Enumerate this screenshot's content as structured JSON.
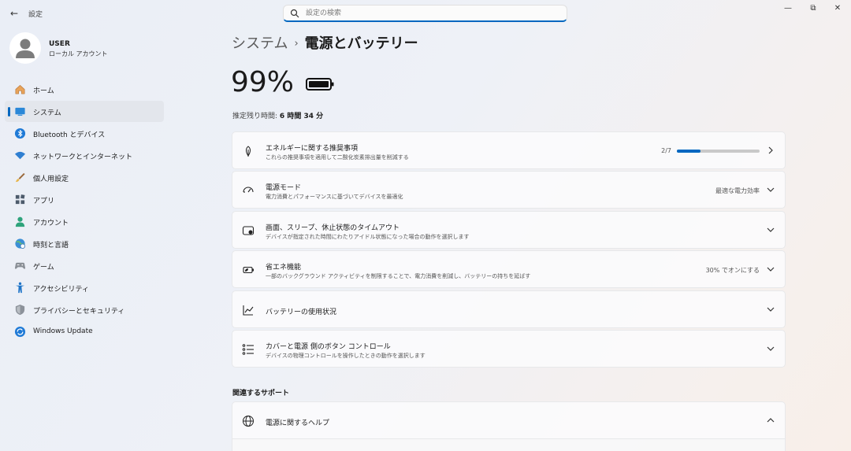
{
  "app": {
    "title": "設定",
    "search_placeholder": "設定の検索",
    "window_controls": [
      "minimize",
      "maximize",
      "close"
    ]
  },
  "profile": {
    "name": "USER",
    "account_type": "ローカル アカウント"
  },
  "nav": {
    "items": [
      {
        "label": "ホーム",
        "icon": "home-icon",
        "active": false
      },
      {
        "label": "システム",
        "icon": "system-icon",
        "active": true
      },
      {
        "label": "Bluetooth とデバイス",
        "icon": "bluetooth-icon",
        "active": false
      },
      {
        "label": "ネットワークとインターネット",
        "icon": "wifi-icon",
        "active": false
      },
      {
        "label": "個人用設定",
        "icon": "brush-icon",
        "active": false
      },
      {
        "label": "アプリ",
        "icon": "apps-icon",
        "active": false
      },
      {
        "label": "アカウント",
        "icon": "account-icon",
        "active": false
      },
      {
        "label": "時刻と言語",
        "icon": "globe-clock-icon",
        "active": false
      },
      {
        "label": "ゲーム",
        "icon": "gamepad-icon",
        "active": false
      },
      {
        "label": "アクセシビリティ",
        "icon": "accessibility-icon",
        "active": false
      },
      {
        "label": "プライバシーとセキュリティ",
        "icon": "shield-icon",
        "active": false
      },
      {
        "label": "Windows Update",
        "icon": "update-icon",
        "active": false
      }
    ]
  },
  "breadcrumb": {
    "parent": "システム",
    "separator": "›",
    "current": "電源とバッテリー"
  },
  "battery": {
    "percent": "99%",
    "estimate_label": "推定残り時間:",
    "estimate_value": "6 時間 34 分"
  },
  "cards": [
    {
      "title": "エネルギーに関する推奨事項",
      "subtitle": "これらの推奨事項を適用して二酸化炭素排出量を削減する",
      "progress_text": "2/7",
      "progress": 0.2857,
      "chevron": "right"
    },
    {
      "title": "電源モード",
      "subtitle": "電力消費とパフォーマンスに基づいてデバイスを最適化",
      "value": "最適な電力効率",
      "chevron": "down"
    },
    {
      "title": "画面、スリープ、休止状態のタイムアウト",
      "subtitle": "デバイスが指定された時間にわたりアイドル状態になった場合の動作を選択します",
      "chevron": "down"
    },
    {
      "title": "省エネ機能",
      "subtitle": "一部のバックグラウンド アクティビティを制限することで、電力消費を削減し、バッテリーの持ちを延ばす",
      "value": "30% でオンにする",
      "chevron": "down"
    },
    {
      "title": "バッテリーの使用状況",
      "chevron": "down"
    },
    {
      "title": "カバーと電源 側のボタン コントロール",
      "subtitle": "デバイスの物理コントロールを操作したときの動作を選択します",
      "chevron": "down"
    }
  ],
  "related": {
    "section_title": "関連するサポート",
    "help_title": "電源に関するヘルプ"
  },
  "colors": {
    "accent": "#0067c0"
  }
}
